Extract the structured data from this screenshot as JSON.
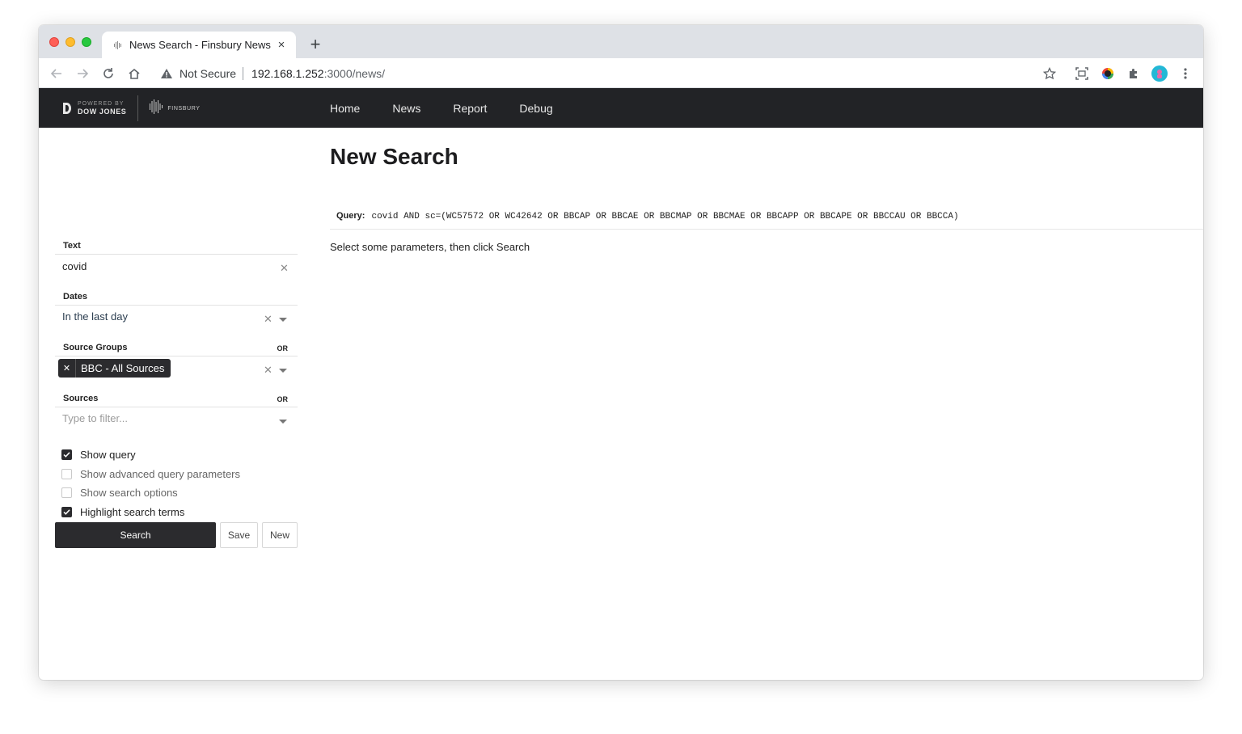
{
  "browser": {
    "tab_title": "News Search - Finsbury News",
    "security_label": "Not Secure",
    "url_host": "192.168.1.252",
    "url_rest": ":3000/news/"
  },
  "site": {
    "logo_small": "POWERED BY",
    "logo_big": "DOW JONES",
    "logo_brand": "FINSBURY",
    "nav": [
      {
        "label": "Home"
      },
      {
        "label": "News"
      },
      {
        "label": "Report"
      },
      {
        "label": "Debug"
      }
    ]
  },
  "sidebar": {
    "text": {
      "label": "Text",
      "value": "covid"
    },
    "dates": {
      "label": "Dates",
      "value": "In the last day"
    },
    "source_groups": {
      "label": "Source Groups",
      "operator": "OR",
      "chips": [
        "BBC - All Sources"
      ]
    },
    "sources": {
      "label": "Sources",
      "operator": "OR",
      "placeholder": "Type to filter..."
    },
    "options": [
      {
        "label": "Show query",
        "checked": true
      },
      {
        "label": "Show advanced query parameters",
        "checked": false
      },
      {
        "label": "Show search options",
        "checked": false
      },
      {
        "label": "Highlight search terms",
        "checked": true
      }
    ],
    "buttons": {
      "search": "Search",
      "save": "Save",
      "new": "New"
    }
  },
  "main": {
    "title": "New Search",
    "query_label": "Query:",
    "query": "covid AND sc=(WC57572 OR WC42642 OR BBCAP OR BBCAE OR BBCMAP OR BBCMAE OR BBCAPP OR BBCAPE OR BBCCAU OR BBCCA)",
    "hint": "Select some parameters, then click Search"
  },
  "colors": {
    "nav_bg": "#222326",
    "accent_dark": "#2b2b2e",
    "tab_strip": "#dee1e6"
  }
}
